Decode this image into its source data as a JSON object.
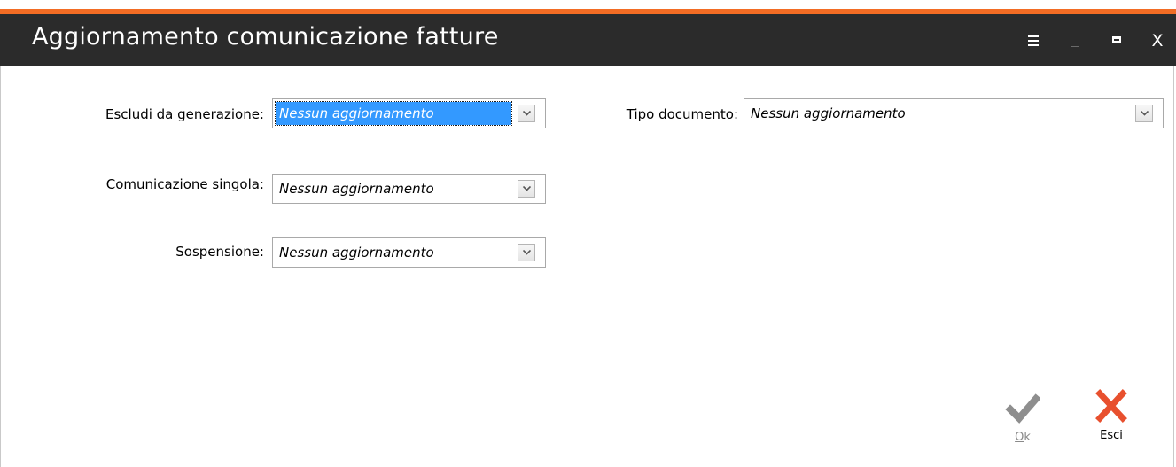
{
  "window": {
    "title": "Aggiornamento comunicazione fatture",
    "accent_color": "#f26c24",
    "titlebar_color": "#2b2b2b",
    "controls": {
      "menu_icon": "hamburger-menu-icon",
      "minimize_icon": "minimize-icon",
      "maximize_icon": "maximize-icon",
      "close_label": "X"
    }
  },
  "form": {
    "escludi": {
      "label": "Escludi da generazione:",
      "value": "Nessun aggiornamento",
      "focused": true
    },
    "singola": {
      "label": "Comunicazione singola:",
      "value": "Nessun aggiornamento"
    },
    "sospensione": {
      "label": "Sospensione:",
      "value": "Nessun aggiornamento"
    },
    "tipo": {
      "label": "Tipo documento:",
      "value": "Nessun aggiornamento"
    }
  },
  "actions": {
    "ok": {
      "label": "Ok",
      "icon": "checkmark-icon",
      "enabled": false
    },
    "exit": {
      "label": "Esci",
      "icon": "close-x-icon",
      "color": "#e8502e"
    }
  }
}
